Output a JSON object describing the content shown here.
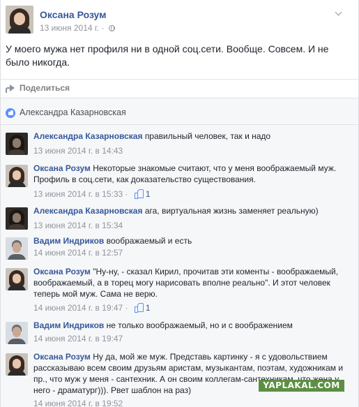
{
  "post": {
    "author": "Оксана Розум",
    "date": "13 июня 2014 г.",
    "text": "У моего мужа нет профиля ни в одной соц.сети. Вообще. Совсем. И не было никогда.",
    "share_label": "Поделиться"
  },
  "likes": {
    "name": "Александра Казарновская"
  },
  "comments": [
    {
      "author": "Александра Казарновская",
      "text": "правильный человек, так и надо",
      "meta": "13 июня 2014 г. в 14:43"
    },
    {
      "author": "Оксана Розум",
      "text": "Некоторые знакомые считают, что у меня воображаемый муж. Профиль в соц.сети, как доказательство существования.",
      "meta": "13 июня 2014 г. в 15:33",
      "separator": " · ",
      "likes": "1"
    },
    {
      "author": "Александра Казарновская",
      "text": "ага, виртуальная жизнь заменяет реальную)",
      "meta": "13 июня 2014 г. в 15:34"
    },
    {
      "author": "Вадим Индриков",
      "text": "воображаемый и есть",
      "meta": "14 июня 2014 г. в 12:57"
    },
    {
      "author": "Оксана Розум",
      "text": "\"Ну-ну, - сказал Кирил, прочитав эти коменты - воображаемый, воображаемый, а в торец могу нарисовать вполне реально\". И этот человек теперь мой муж. Сама не верю.",
      "meta": "14 июня 2014 г. в 19:47",
      "separator": " · ",
      "likes": "1"
    },
    {
      "author": "Вадим Индриков",
      "text": "не только воображаемый, но и с воображением",
      "meta": "14 июня 2014 г. в 19:47"
    },
    {
      "author": "Оксана Розум",
      "text": "Ну да, мой же муж. Представь картинку - я с удовольствием рассказываю всем своим друзьям аристам, музыкантам, поэтам, художникам и пр., что муж у меня - сантехник. А он своим коллегам-сантехникам, что жена у него - драматург))). Рвет шаблон на раз)",
      "meta": "14 июня 2014 г. в 19:52"
    }
  ],
  "watermark": "YAPLAKAL.COM",
  "icons": {
    "privacy": "globe-icon",
    "menu": "chevron-down-icon",
    "share": "share-icon",
    "like": "like-icon",
    "comment_like": "thumb-icon"
  },
  "colors": {
    "link": "#365899",
    "meta": "#90949c",
    "like_blue": "#5890ff",
    "comments_bg": "#f6f7f9",
    "watermark_bg": "#5d8f43"
  }
}
